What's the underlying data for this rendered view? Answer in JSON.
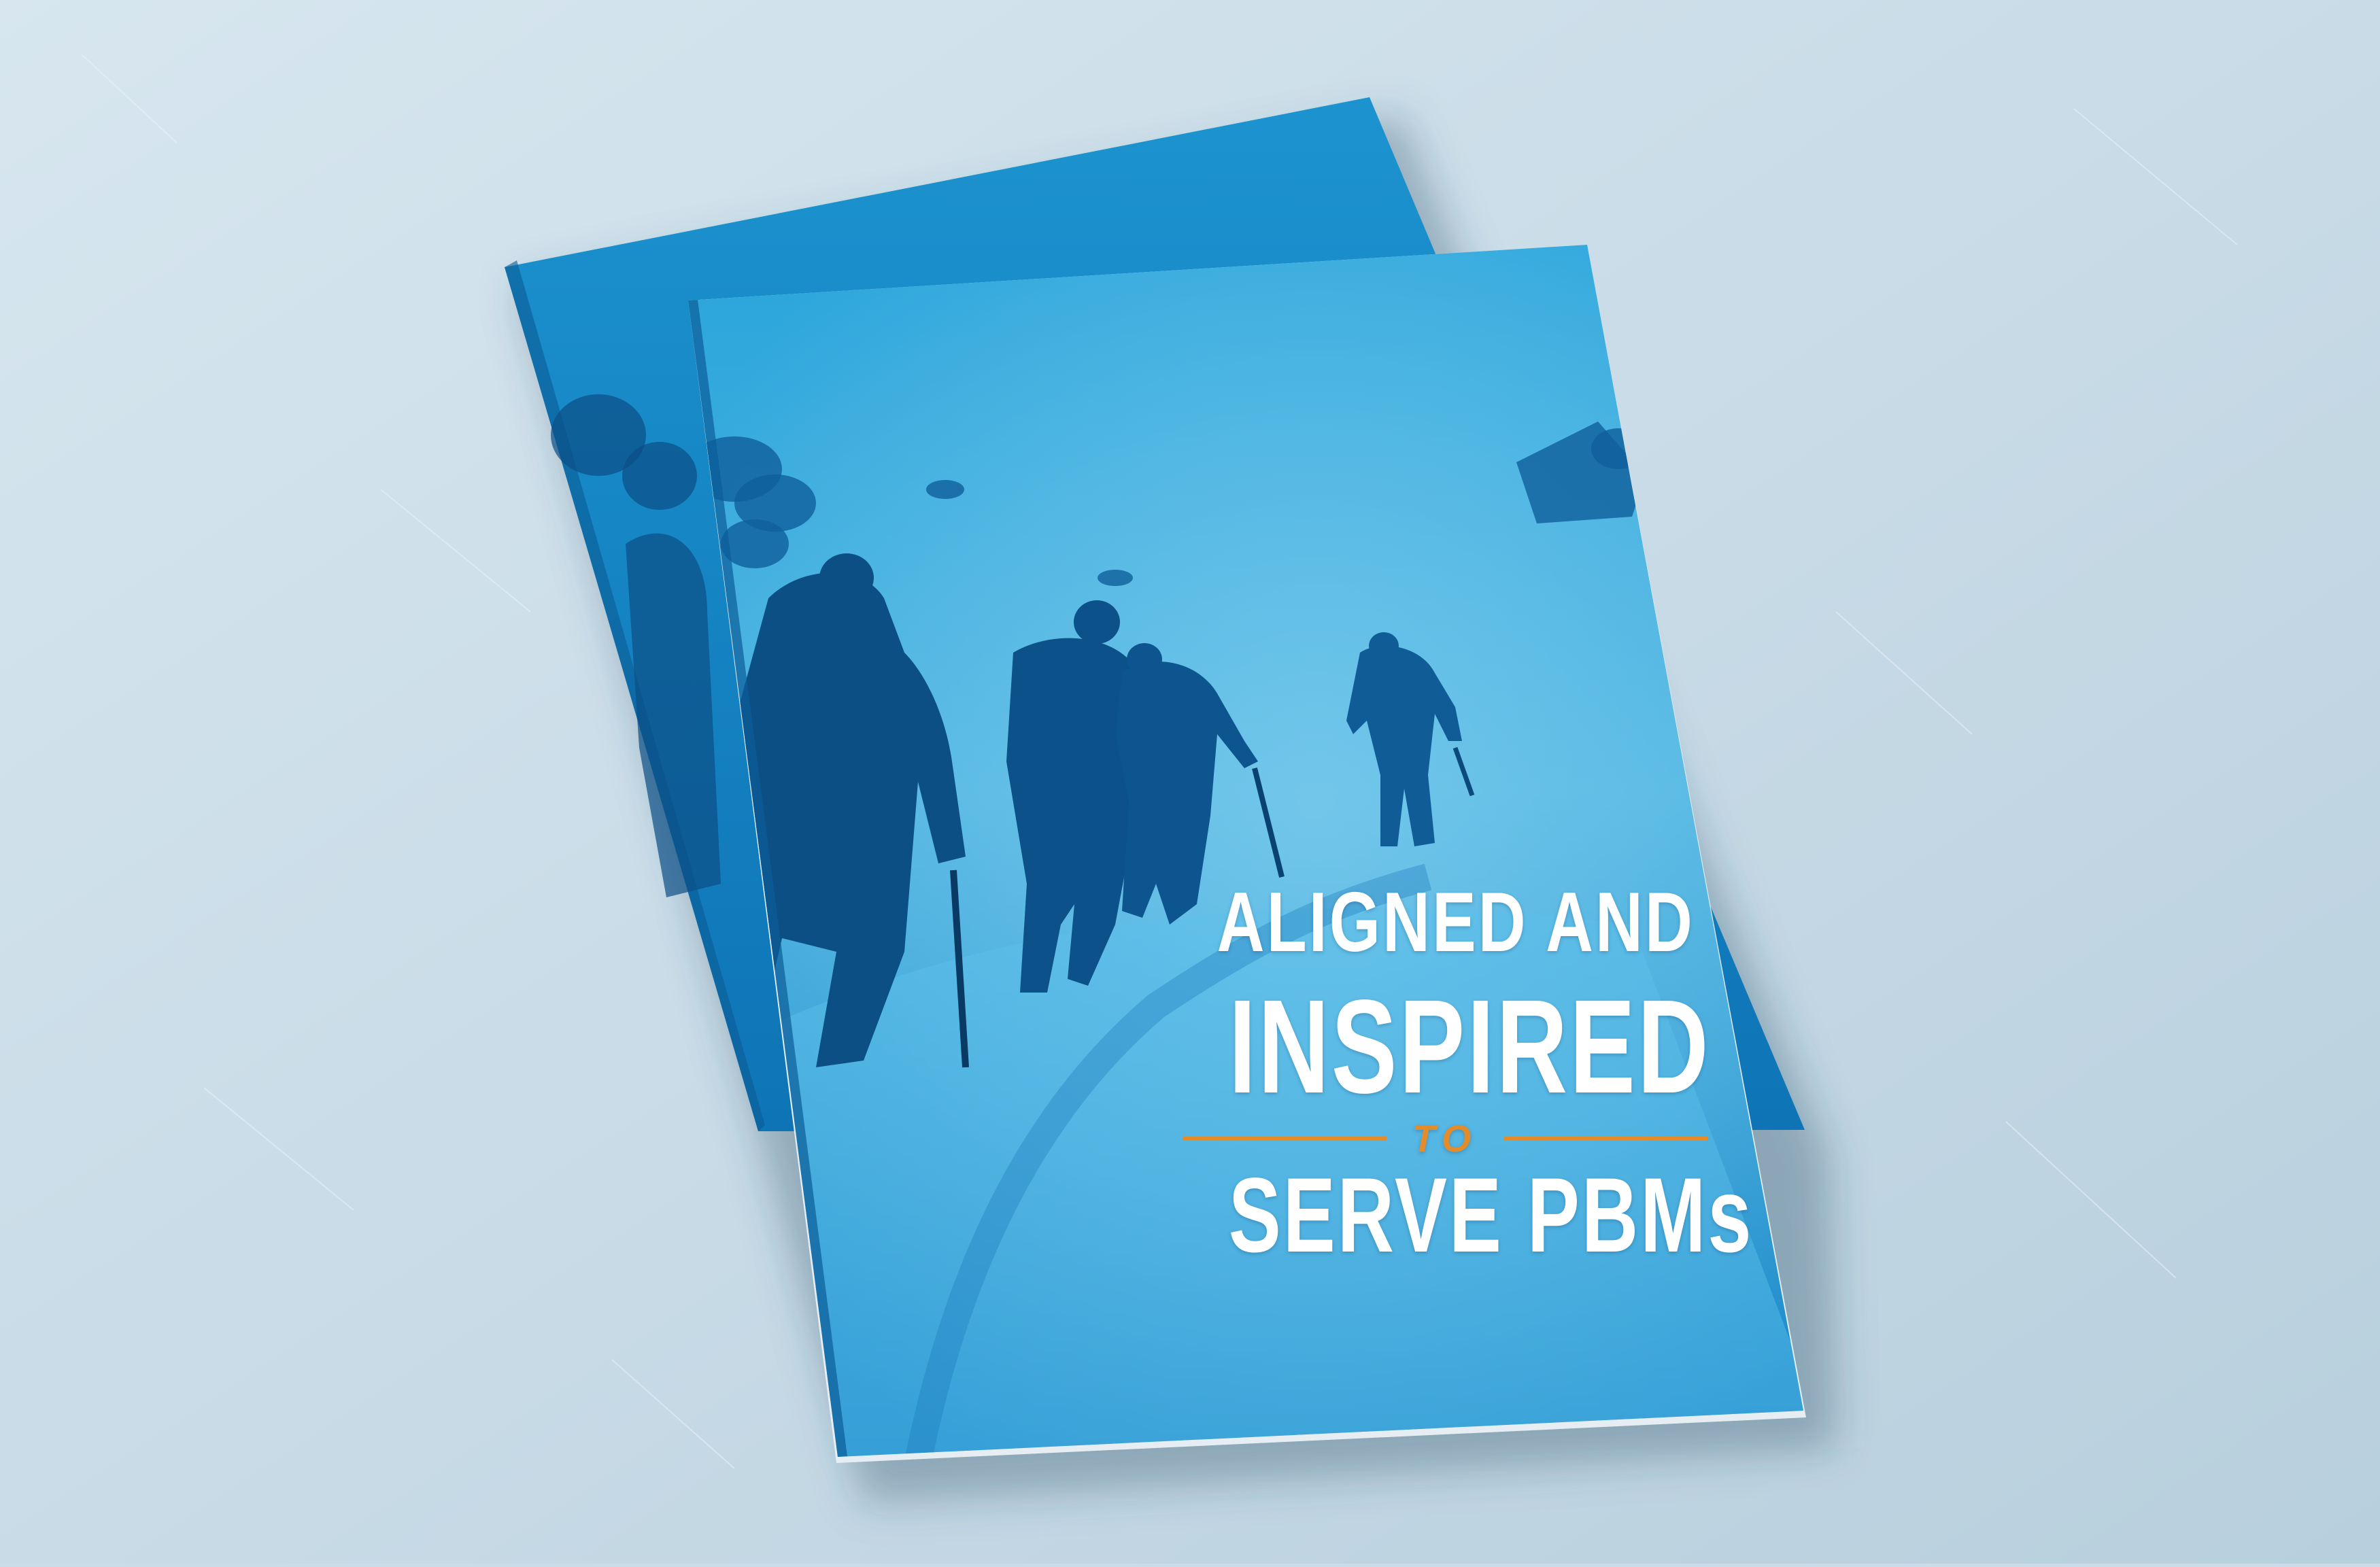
{
  "cover": {
    "line1": "ALIGNED AND",
    "line2": "INSPIRED",
    "line3": "TO",
    "line4": "SERVE PBMs"
  },
  "colors": {
    "background": "#c9dce7",
    "cover_blue": "#1a93d2",
    "cover_blue_dark": "#0b5f99",
    "accent_orange": "#e48c2a",
    "title_white": "#ffffff"
  }
}
